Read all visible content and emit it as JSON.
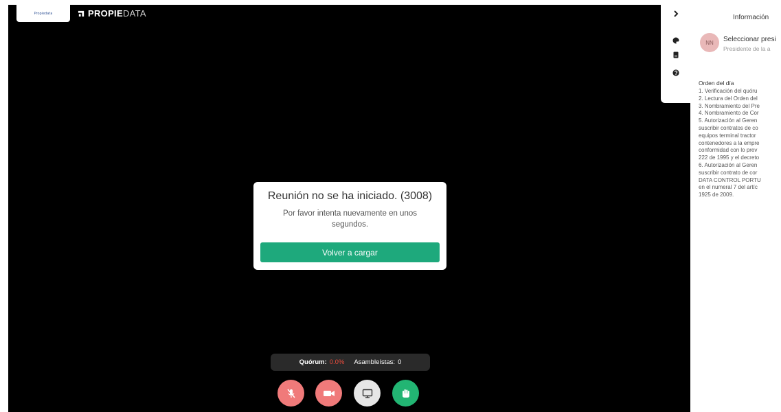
{
  "logo": {
    "text": "Propiedata"
  },
  "brand": {
    "part1": "PROPIE",
    "part2": "DATA"
  },
  "modal": {
    "title": "Reunión no se ha iniciado. (3008)",
    "message": "Por favor intenta nuevamente en unos segundos.",
    "button": "Volver a cargar"
  },
  "status": {
    "quorum_label": "Quórum:",
    "quorum_value": "0.0%",
    "attendees_label": "Asambleístas:",
    "attendees_value": "0"
  },
  "controls": [
    {
      "icon": "mic-off-icon",
      "color": "#f07a7a"
    },
    {
      "icon": "video-camera-icon",
      "color": "#f07a7a"
    },
    {
      "icon": "screen-share-icon",
      "color": "#e6e6e6"
    },
    {
      "icon": "raise-hand-icon",
      "color": "#22b573"
    }
  ],
  "sidebar": {
    "tabs": [
      "chevron-right-icon",
      "palette-icon",
      "document-icon",
      "help-icon"
    ],
    "title": "Información",
    "president": {
      "initials": "NN",
      "name": "Seleccionar presi",
      "role": "Presidente de la a"
    },
    "agenda": {
      "title": "Orden del día",
      "lines": [
        "1. Verificación del quóru",
        "2. Lectura del Orden del",
        "3. Nombramiento del Pre",
        "4. Nombramiento de Cor",
        "5. Autorización al Geren",
        "suscribir contratos de co",
        "equipos terminal tractor",
        "contenedores a la empre",
        "conformidad con lo prev",
        "222 de 1995 y el decreto",
        "6. Autorización al Geren",
        "suscribir contrato de cor",
        "DATA CONTROL PORTU",
        "en el numeral 7 del artíc",
        "1925 de 2009."
      ]
    }
  },
  "colors": {
    "accent_green": "#1ea97c",
    "danger_red": "#f07a7a",
    "quorum_red": "#e74c3c",
    "background": "#000000"
  }
}
